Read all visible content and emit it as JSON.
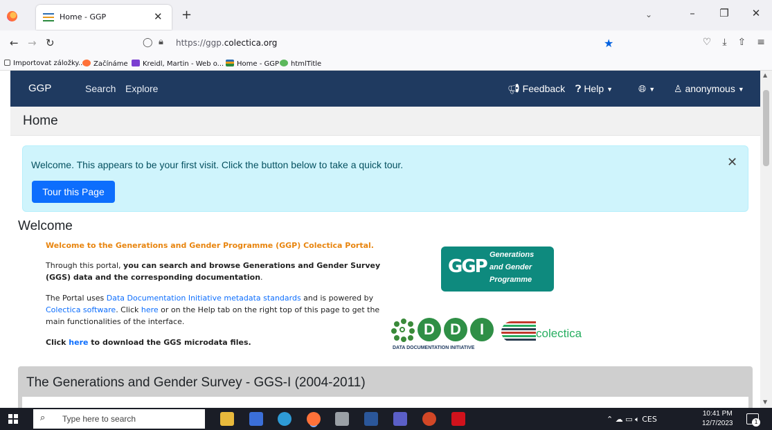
{
  "browser": {
    "tab_title": "Home - GGP",
    "url_prefix": "https://ggp.",
    "url_domain": "colectica.org",
    "bookmarks": [
      {
        "label": "Importovat záložky..."
      },
      {
        "label": "Začínáme"
      },
      {
        "label": "Kreidl, Martin - Web o..."
      },
      {
        "label": "Home - GGP"
      },
      {
        "label": "htmlTitle"
      }
    ]
  },
  "app_nav": {
    "brand": "GGP",
    "links": [
      "Search",
      "Explore"
    ],
    "feedback": "Feedback",
    "help": "Help",
    "user": "anonymous"
  },
  "page": {
    "title": "Home",
    "alert": {
      "text": "Welcome. This appears to be your first visit. Click the button below to take a quick tour.",
      "button": "Tour this Page"
    },
    "welcome": {
      "heading": "Welcome",
      "intro": "Welcome to the Generations and Gender Programme (GGP) Colectica Portal.",
      "p1_a": "Through this portal, ",
      "p1_b": "you can search and browse Generations and Gender Survey (GGS) data and the corresponding documentation",
      "p1_c": ".",
      "p2_a": "The Portal uses ",
      "p2_link1": "Data Documentation Initiative metadata standards",
      "p2_b": " and is powered by ",
      "p2_link2": "Colectica software",
      "p2_c": ". Click ",
      "p2_link3": "here",
      "p2_d": " or on the Help tab on the right top of this page to get the main functionalities of the interface.",
      "p3_a": "Click ",
      "p3_link": "here",
      "p3_b": " to download the GGS microdata files."
    },
    "logos": {
      "ggp_mark": "GGP",
      "ggp_lines": [
        "Generations",
        "and Gender",
        "Programme"
      ],
      "ddi_letters": [
        "D",
        "D",
        "I"
      ],
      "ddi_caption": "DATA DOCUMENTATION INITIATIVE",
      "colectica": "colectica"
    },
    "section_title": "The Generations and Gender Survey - GGS-I (2004-2011)"
  },
  "taskbar": {
    "search_placeholder": "Type here to search",
    "tray_lang": "CES",
    "time": "10:41 PM",
    "date": "12/7/2023",
    "notifications": "1"
  },
  "colors": {
    "nav_bg": "#1f3a60",
    "alert_bg": "#cff4fc",
    "button": "#0d6efd",
    "accent_orange": "#e8850f",
    "ggp_green": "#0e8a7e"
  }
}
